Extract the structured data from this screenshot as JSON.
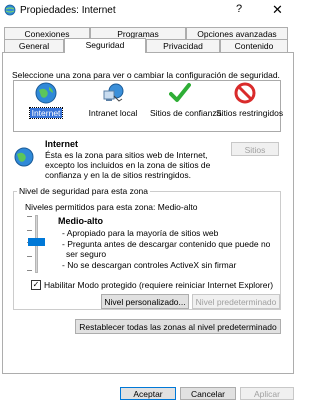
{
  "window": {
    "title": "Propiedades: Internet",
    "help": "?",
    "close": "✕"
  },
  "tabs": {
    "row1": [
      "Conexiones",
      "Programas",
      "Opciones avanzadas"
    ],
    "row2": [
      "General",
      "Seguridad",
      "Privacidad",
      "Contenido"
    ],
    "active": "Seguridad"
  },
  "zones": {
    "instruction": "Seleccione una zona para ver o cambiar la configuración de seguridad.",
    "items": [
      {
        "label": "Internet",
        "icon": "globe-icon"
      },
      {
        "label": "Intranet local",
        "icon": "network-icon"
      },
      {
        "label": "Sitios de confianza",
        "icon": "checkmark-icon"
      },
      {
        "label": "Sitios restringidos",
        "icon": "no-entry-icon"
      }
    ],
    "selected": "Internet"
  },
  "zone_info": {
    "title": "Internet",
    "description": "Ésta es la zona para sitios web de Internet, excepto los incluidos en la zona de sitios de confianza y en la de sitios restringidos.",
    "sites_button": "Sitios"
  },
  "security_level": {
    "group_title": "Nivel de seguridad para esta zona",
    "allowed_levels": "Niveles permitidos para esta zona: Medio-alto",
    "level_name": "Medio-alto",
    "bullets": [
      "- Apropiado para la mayoría de sitios web",
      "- Pregunta antes de descargar contenido que puede no ser seguro",
      "- No se descargan controles ActiveX sin firmar"
    ],
    "protected_mode_label": "Habilitar Modo protegido (requiere reiniciar Internet Explorer)",
    "protected_mode_checked": true,
    "custom_level_button": "Nivel personalizado...",
    "default_level_button": "Nivel predeterminado",
    "reset_all_button": "Restablecer todas las zonas al nivel predeterminado"
  },
  "footer": {
    "accept": "Aceptar",
    "cancel": "Cancelar",
    "apply": "Aplicar"
  },
  "colors": {
    "accent": "#0078d7",
    "selection": "#3874d8"
  }
}
